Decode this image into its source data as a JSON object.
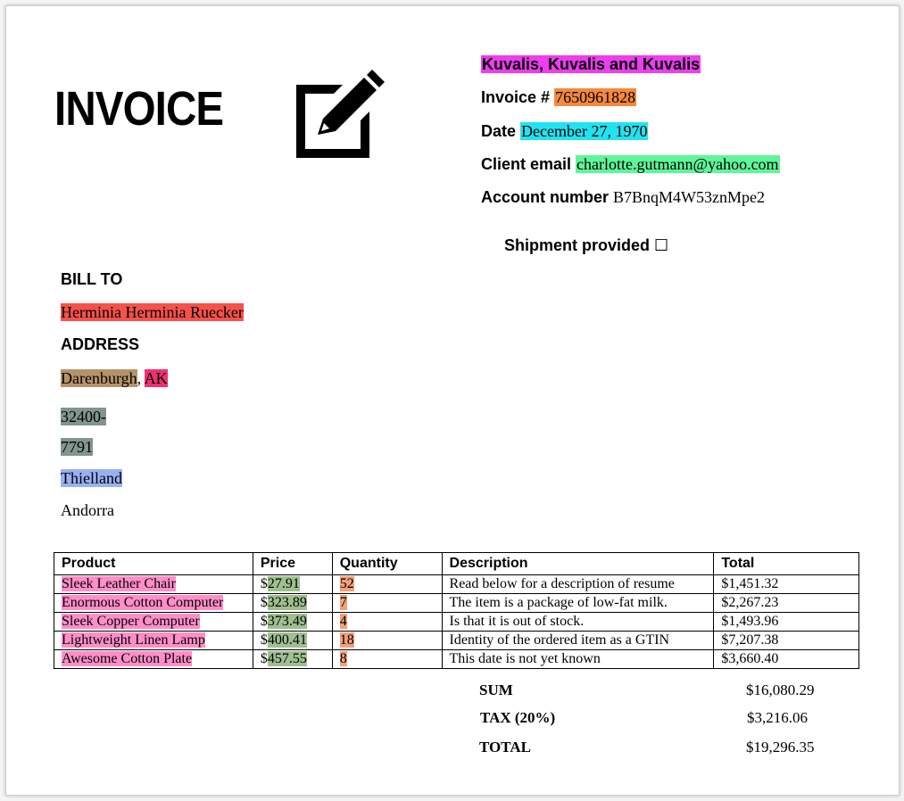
{
  "document": {
    "title": "INVOICE",
    "company": "Kuvalis, Kuvalis and Kuvalis",
    "invoice_label": "Invoice #",
    "invoice_number": "7650961828",
    "date_label": "Date",
    "date": "December 27, 1970",
    "email_label": "Client email",
    "email": "charlotte.gutmann@yahoo.com",
    "account_label": "Account number",
    "account": "B7BnqM4W53znMpe2",
    "shipment_label": "Shipment provided",
    "shipment_checkbox": "☐"
  },
  "bill_to": {
    "label": "BILL TO",
    "name": "Herminia Herminia Ruecker",
    "address_label": "ADDRESS",
    "city": "Darenburgh",
    "comma": ",",
    "state": "AK",
    "zip_part1": "32400-",
    "zip_part2": "7791",
    "region": "Thielland",
    "country": "Andorra"
  },
  "table": {
    "headers": [
      "Product",
      "Price",
      "Quantity",
      "Description",
      "Total"
    ],
    "rows": [
      {
        "product": "Sleek Leather Chair",
        "price_symbol": "$",
        "price": "27.91",
        "qty": "52",
        "desc": "Read below for a description of resume",
        "total": "$1,451.32"
      },
      {
        "product": "Enormous Cotton Computer",
        "price_symbol": "$",
        "price": "323.89",
        "qty": "7",
        "desc": "The item is a package of low-fat milk.",
        "total": "$2,267.23"
      },
      {
        "product": "Sleek Copper Computer",
        "price_symbol": "$",
        "price": "373.49",
        "qty": "4",
        "desc": "Is that it is out of stock.",
        "total": "$1,493.96"
      },
      {
        "product": "Lightweight Linen Lamp",
        "price_symbol": "$",
        "price": "400.41",
        "qty": "18",
        "desc": "Identity of the ordered item as a GTIN",
        "total": "$7,207.38"
      },
      {
        "product": "Awesome Cotton Plate",
        "price_symbol": "$",
        "price": "457.55",
        "qty": "8",
        "desc": "This date is not yet known",
        "total": "$3,660.40"
      }
    ]
  },
  "summary": {
    "sum_label": "SUM",
    "sum_value": "$16,080.29",
    "tax_label": "TAX (20%)",
    "tax_value": "$3,216.06",
    "total_label": "TOTAL",
    "total_value": "$19,296.35"
  },
  "colors": {
    "company_bg": "#ee3cf0",
    "invoice_bg": "#f5893d",
    "date_bg": "#22e2f2",
    "email_bg": "#5ff59a",
    "name_bg": "#f6524a",
    "city_bg": "#b5936a",
    "state_bg": "#ee3170",
    "zip_bg": "#82958e",
    "region_bg": "#99b1f3",
    "product_bg": "#ff8ec8",
    "price_bg": "#9fbf91",
    "qty_bg": "#f4a07a"
  },
  "icons": {
    "header_icon": "edit-icon"
  }
}
